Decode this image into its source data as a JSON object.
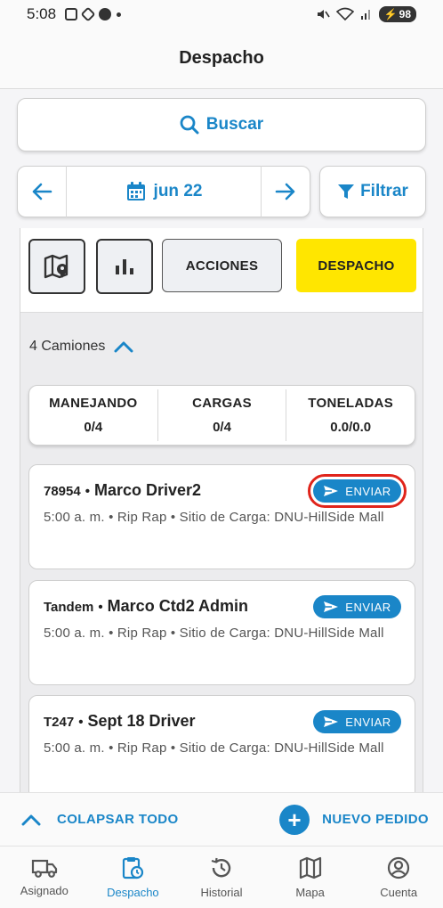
{
  "status_bar": {
    "time": "5:08",
    "battery": "98"
  },
  "header": {
    "title": "Despacho"
  },
  "search": {
    "label": "Buscar"
  },
  "date_nav": {
    "date": "jun 22"
  },
  "filter": {
    "label": "Filtrar"
  },
  "tabs": {
    "acciones": "ACCIONES",
    "despacho": "DESPACHO"
  },
  "trucks": {
    "count_label": "4 Camiones"
  },
  "summary": [
    {
      "label": "MANEJANDO",
      "value": "0/4"
    },
    {
      "label": "CARGAS",
      "value": "0/4"
    },
    {
      "label": "TONELADAS",
      "value": "0.0/0.0"
    }
  ],
  "trips": [
    {
      "id": "78954",
      "driver": "Marco Driver2",
      "detail": "5:00 a. m. • Rip Rap • Sitio de Carga: DNU-HillSide Mall",
      "send_label": "ENVIAR"
    },
    {
      "id": "Tandem",
      "driver": "Marco Ctd2 Admin",
      "detail": "5:00 a. m. • Rip Rap • Sitio de Carga: DNU-HillSide Mall",
      "send_label": "ENVIAR"
    },
    {
      "id": "T247",
      "driver": "Sept 18 Driver",
      "detail": "5:00 a. m. • Rip Rap • Sitio de Carga: DNU-HillSide Mall",
      "send_label": "ENVIAR"
    }
  ],
  "actions": {
    "collapse_all": "COLAPSAR TODO",
    "new_order": "NUEVO PEDIDO"
  },
  "nav": [
    {
      "label": "Asignado",
      "icon": "truck-icon"
    },
    {
      "label": "Despacho",
      "icon": "clipboard-clock-icon"
    },
    {
      "label": "Historial",
      "icon": "history-icon"
    },
    {
      "label": "Mapa",
      "icon": "map-icon"
    },
    {
      "label": "Cuenta",
      "icon": "account-icon"
    }
  ],
  "colors": {
    "accent": "#1a86c8",
    "despacho_yellow": "#ffe600",
    "highlight_red": "#e0241b"
  }
}
